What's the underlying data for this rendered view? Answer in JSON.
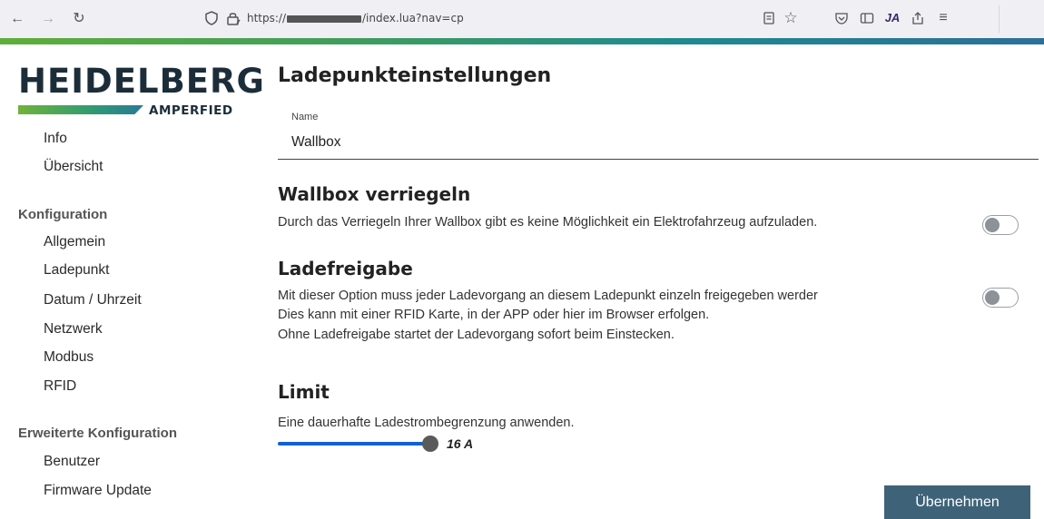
{
  "browser": {
    "url_prefix": "https://",
    "url_suffix": "/index.lua?nav=cp",
    "extension_badge": "JA"
  },
  "logo": {
    "brand": "HEIDELBERG",
    "sub": "AMPERFIED"
  },
  "sidebar": {
    "items_top": [
      {
        "label": "Info"
      },
      {
        "label": "Übersicht"
      }
    ],
    "section_config": "Konfiguration",
    "items_config": [
      {
        "label": "Allgemein"
      },
      {
        "label": "Ladepunkt"
      },
      {
        "label": "Datum / Uhrzeit"
      },
      {
        "label": "Netzwerk"
      },
      {
        "label": "Modbus"
      },
      {
        "label": "RFID"
      }
    ],
    "section_extended": "Erweiterte Konfiguration",
    "items_extended": [
      {
        "label": "Benutzer"
      },
      {
        "label": "Firmware Update"
      }
    ]
  },
  "main": {
    "title": "Ladepunkteinstellungen",
    "name_field": {
      "label": "Name",
      "value": "Wallbox"
    },
    "lock": {
      "heading": "Wallbox verriegeln",
      "description": "Durch das Verriegeln Ihrer Wallbox gibt es keine Möglichkeit ein Elektrofahrzeug aufzuladen.",
      "enabled": false
    },
    "release": {
      "heading": "Ladefreigabe",
      "line1": "Mit dieser Option muss jeder Ladevorgang an diesem Ladepunkt einzeln freigegeben werder",
      "line2": "Dies kann mit einer RFID Karte, in der APP oder hier im Browser erfolgen.",
      "line3": "Ohne Ladefreigabe startet der Ladevorgang sofort beim Einstecken.",
      "enabled": false
    },
    "limit": {
      "heading": "Limit",
      "description": "Eine dauerhafte Ladestrombegrenzung anwenden.",
      "value_label": "16 A"
    },
    "apply_label": "Übernehmen"
  },
  "colors": {
    "button": "#3e6379",
    "slider": "#0f62d6"
  }
}
